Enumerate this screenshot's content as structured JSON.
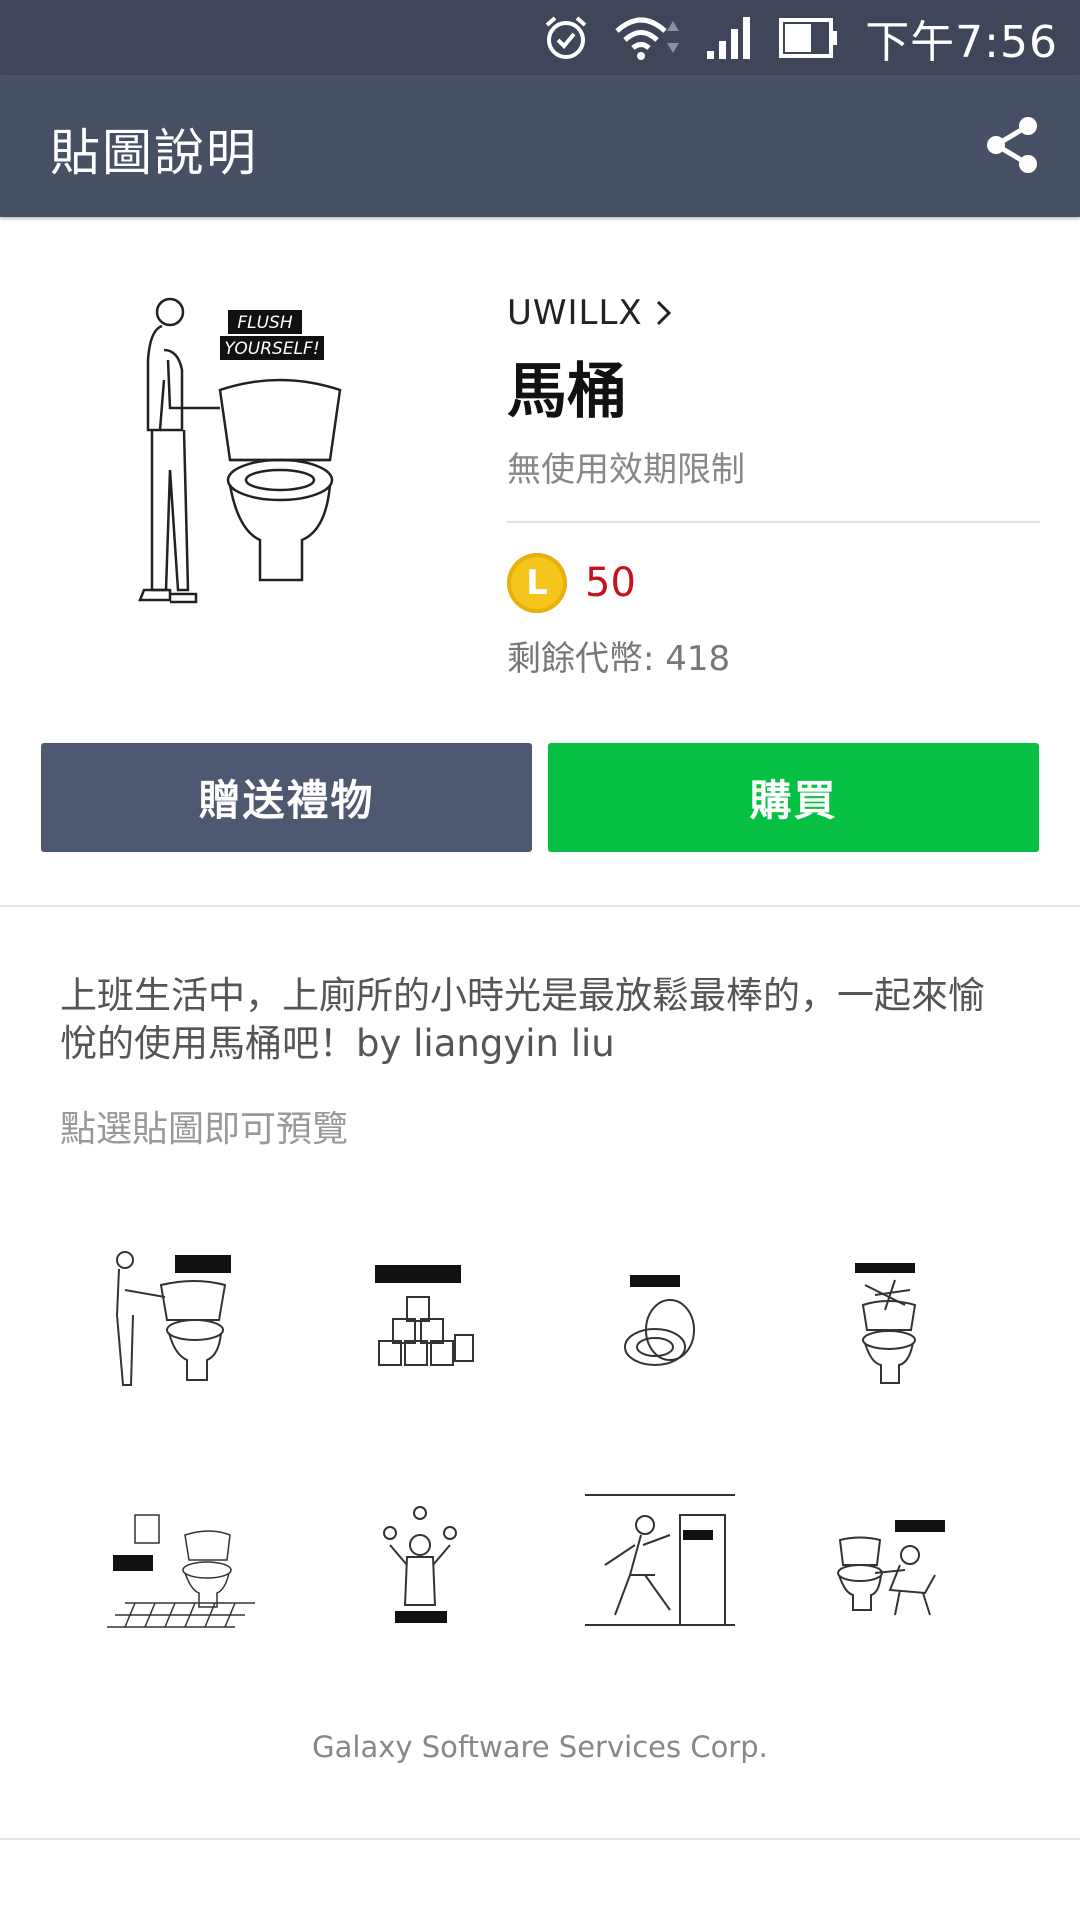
{
  "status_bar": {
    "time": "下午7:56",
    "icons": [
      "alarm-icon",
      "wifi-icon",
      "signal-icon",
      "battery-icon"
    ]
  },
  "header": {
    "title": "貼圖說明",
    "share_icon": "share-icon"
  },
  "product": {
    "author": "UWILLX",
    "name": "馬桶",
    "validity": "無使用效期限制",
    "coin_symbol": "L",
    "price": "50",
    "balance": "剩餘代幣: 418",
    "hero_sign_line1": "FLUSH",
    "hero_sign_line2": "YOURSELF!"
  },
  "buttons": {
    "gift": "贈送禮物",
    "buy": "購買"
  },
  "description": "上班生活中，上廁所的小時光是最放鬆最棒的，一起來愉悅的使用馬桶吧！by liangyin liu",
  "preview_hint": "點選貼圖即可預覽",
  "stickers": [
    {
      "name": "flush-yourself-sticker",
      "caption": "FLUSH YOURSELF!"
    },
    {
      "name": "feel-rich-sticker",
      "caption": "FEEL RICH!"
    },
    {
      "name": "be-polite-sticker",
      "caption": "BE POLITE!"
    },
    {
      "name": "im-working-sticker",
      "caption": "I'M WORKING"
    },
    {
      "name": "perfect-day-sticker",
      "caption": "PERFECT DAY"
    },
    {
      "name": "show-time-sticker",
      "caption": "SHOW TIME!"
    },
    {
      "name": "done-sticker",
      "caption": "DONE!"
    },
    {
      "name": "just-cant-sticker",
      "caption": "JUST CAN'T"
    }
  ],
  "copyright": "Galaxy Software Services Corp.",
  "colors": {
    "status_bar": "#3f4659",
    "header": "#475064",
    "gift_button": "#4f5871",
    "buy_button": "#06c043",
    "price": "#c8121c",
    "coin": "#f6c51b"
  }
}
